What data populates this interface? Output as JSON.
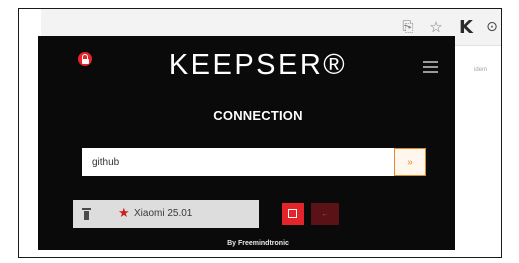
{
  "browser": {
    "icons": {
      "share": "share-icon",
      "star": "star-icon",
      "extension": "extension-icon"
    },
    "keepser_ext_label": "K",
    "background_hint": "idem"
  },
  "popup": {
    "lock_icon": "lock-icon",
    "logo": "KEEPSER®",
    "menu_icon": "hamburger-menu-icon",
    "subtitle": "CONNECTION",
    "search": {
      "value": "github",
      "placeholder": "",
      "button_label": "»"
    },
    "results": [
      {
        "favorite": true,
        "label": "Xiaomi 25.01"
      }
    ],
    "alt_button_label": "←",
    "footer": "By Freemindtronic"
  },
  "colors": {
    "popup_bg": "#0a0a0a",
    "accent_red": "#e3242b",
    "search_button_border": "#e08a2e",
    "result_row_bg": "#dddddd"
  }
}
